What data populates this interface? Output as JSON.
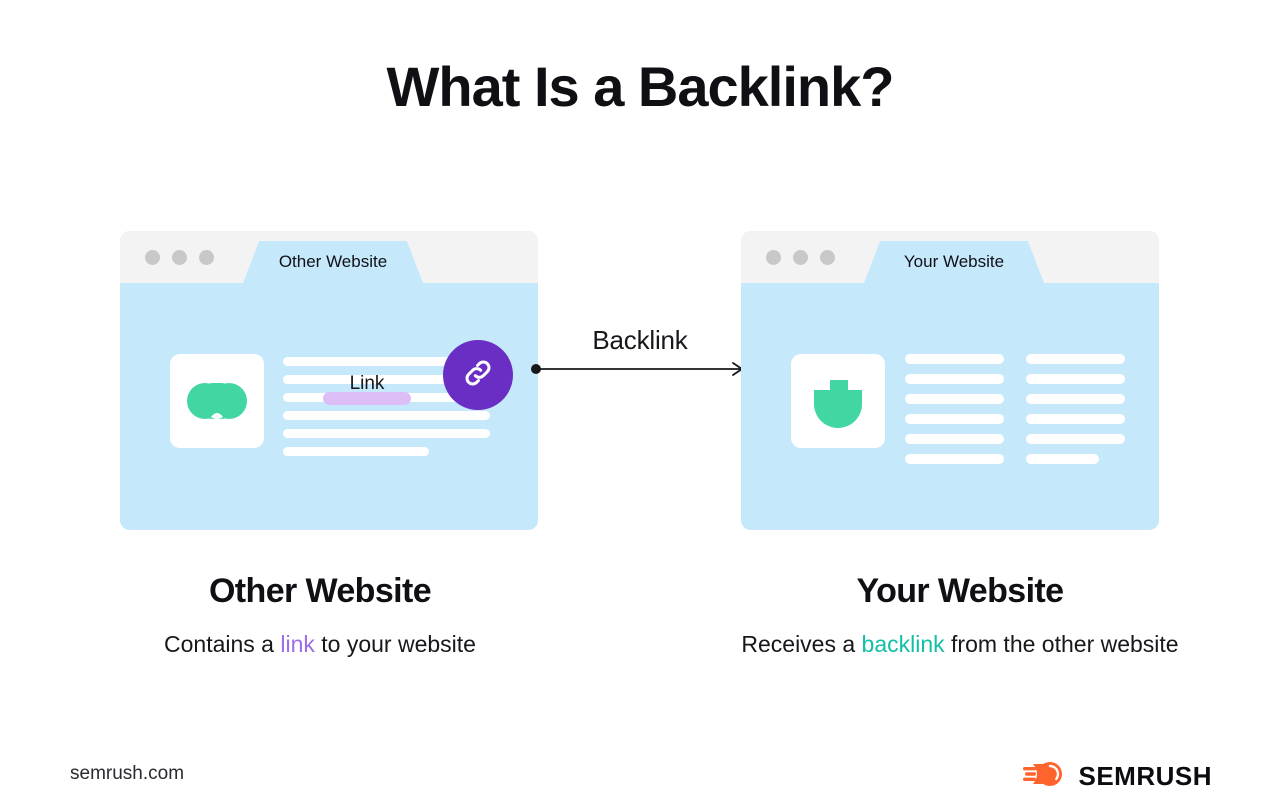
{
  "page": {
    "title": "What Is a Backlink?",
    "background": "#FFFFFF"
  },
  "colors": {
    "window_body": "#C5E8FB",
    "chrome_bar": "#F3F3F3",
    "chrome_dot": "#C8C8C8",
    "line_placeholder": "#FFFFFF",
    "link_badge": "#6A2EC4",
    "link_highlight": "#DCBDF5",
    "logo_green": "#42D6A2",
    "accent_purple": "#9B6DE8",
    "accent_teal": "#13BFA6",
    "brand_orange": "#FF642D",
    "text_dark": "#0F0F14"
  },
  "diagram": {
    "left_window": {
      "tab_label": "Other Website",
      "dots_count": 3,
      "logo_icon": "double-blob-logo-icon",
      "lines": [
        {
          "width": "full"
        },
        {
          "width": "full"
        },
        {
          "width": "full"
        },
        {
          "width": "full"
        },
        {
          "width": "full"
        },
        {
          "width": "short"
        }
      ],
      "link_label": "Link",
      "link_badge_icon": "chain-link-icon"
    },
    "right_window": {
      "tab_label": "Your Website",
      "dots_count": 3,
      "logo_icon": "shield-logo-icon",
      "columns": [
        {
          "lines": [
            {
              "width": "full"
            },
            {
              "width": "full"
            },
            {
              "width": "full"
            },
            {
              "width": "full"
            },
            {
              "width": "full"
            },
            {
              "width": "full"
            }
          ]
        },
        {
          "lines": [
            {
              "width": "full"
            },
            {
              "width": "full"
            },
            {
              "width": "full"
            },
            {
              "width": "full"
            },
            {
              "width": "full"
            },
            {
              "width": "short"
            }
          ]
        }
      ]
    },
    "connector": {
      "label": "Backlink",
      "direction": "left-to-right",
      "start_marker": "dot",
      "end_marker": "arrowhead"
    }
  },
  "captions": {
    "left": {
      "title": "Other Website",
      "sub_before": "Contains a ",
      "sub_highlight": "link",
      "sub_after": " to your website"
    },
    "right": {
      "title": "Your Website",
      "sub_before": "Receives a ",
      "sub_highlight": "backlink",
      "sub_after": " from the other website"
    }
  },
  "footer": {
    "url": "semrush.com",
    "brand_name": "SEMRUSH",
    "brand_mark_icon": "semrush-comet-logo-icon"
  }
}
